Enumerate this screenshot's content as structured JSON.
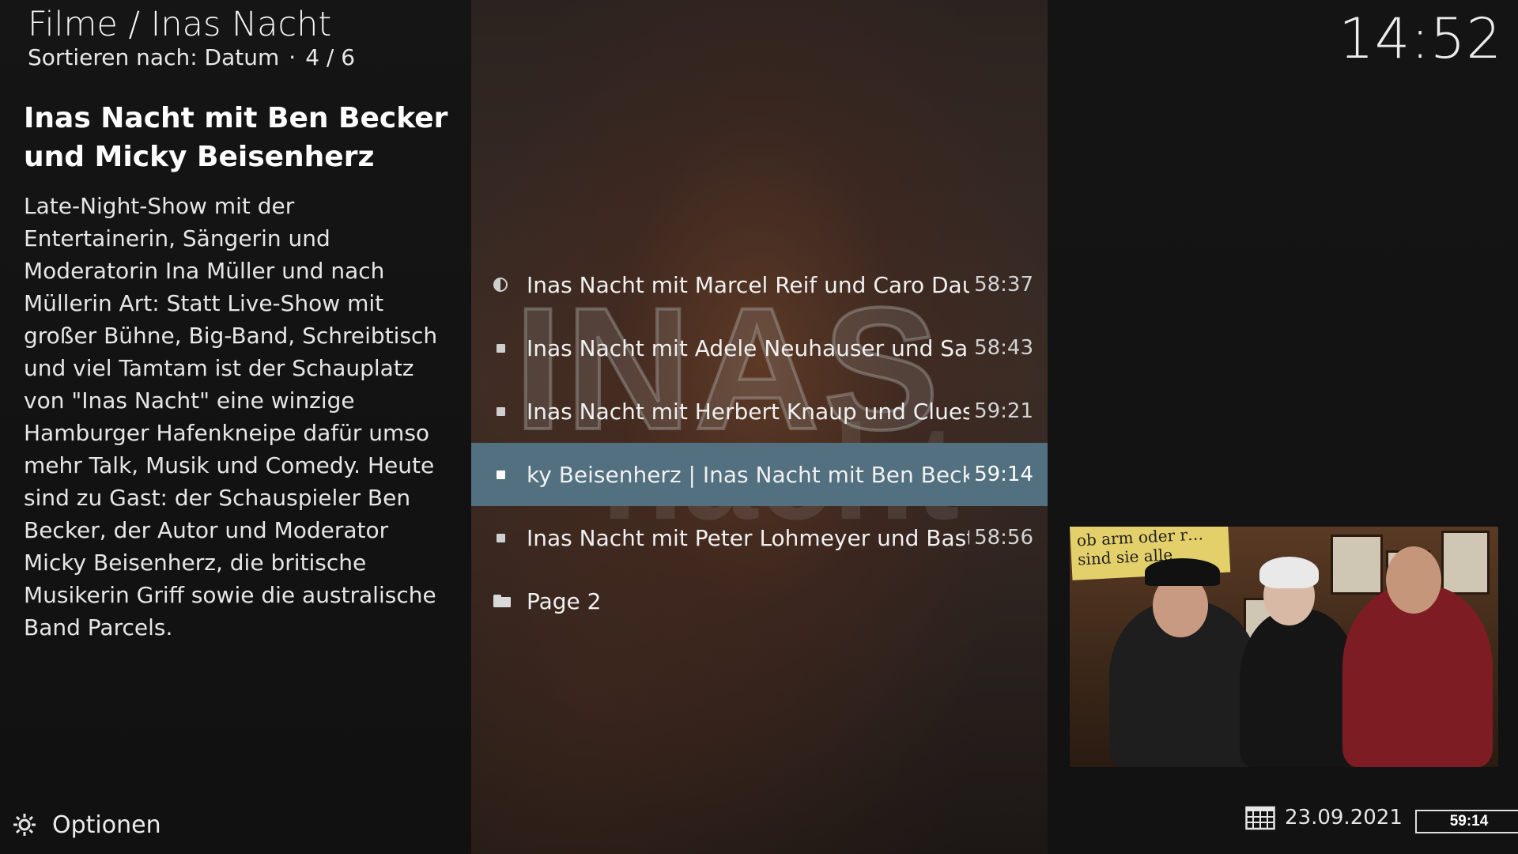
{
  "header": {
    "title": "Filme / Inas Nacht",
    "sort_label": "Sortieren nach: Datum",
    "separator": "·",
    "position": "4 / 6"
  },
  "clock": "14:52",
  "item": {
    "title": "Inas Nacht mit Ben Becker und Micky Beisenherz",
    "plot": "Late-Night-Show mit der Entertainerin, Sängerin und Moderatorin Ina Müller und nach Müllerin Art: Statt Live-Show mit großer Bühne, Big-Band, Schreibtisch und viel Tamtam ist der Schauplatz von \"Inas Nacht\" eine winzige Hamburger Hafenkneipe dafür umso mehr Talk, Musik und Comedy. Heute sind zu Gast: der Schauspieler Ben Becker, der Autor und Moderator Micky Beisenherz, die britische Musikerin Griff sowie die australische Band Parcels."
  },
  "episodes": [
    {
      "status": "in-progress",
      "title": "Inas Nacht mit Marcel Reif und Caro Daur",
      "duration": "58:37",
      "focused": false
    },
    {
      "status": "unwatched",
      "title": "Inas Nacht mit Adele Neuhauser und Sarah ...",
      "duration": "58:43",
      "focused": false
    },
    {
      "status": "unwatched",
      "title": "Inas Nacht mit Herbert Knaup und Clueso",
      "duration": "59:21",
      "focused": false
    },
    {
      "status": "unwatched",
      "title": "ky Beisenherz | Inas Nacht mit Ben Becker und",
      "duration": "59:14",
      "focused": true
    },
    {
      "status": "unwatched",
      "title": "Inas Nacht mit Peter Lohmeyer und Bastian ...",
      "duration": "58:56",
      "focused": false
    },
    {
      "status": "folder",
      "title": "Page 2",
      "duration": "",
      "focused": false
    }
  ],
  "background_logo": {
    "line1": "INAS",
    "line2": "nacht"
  },
  "thumbnail": {
    "sign_text": "ob arm oder r… sind sie alle"
  },
  "footer": {
    "options_label": "Optionen",
    "options_icon": "gear-icon",
    "date": "23.09.2021",
    "date_icon": "calendar-icon",
    "duration": "59:14"
  },
  "colors": {
    "focus_bar": "#52707f",
    "background": "#121212",
    "text": "#f2f2f2"
  }
}
